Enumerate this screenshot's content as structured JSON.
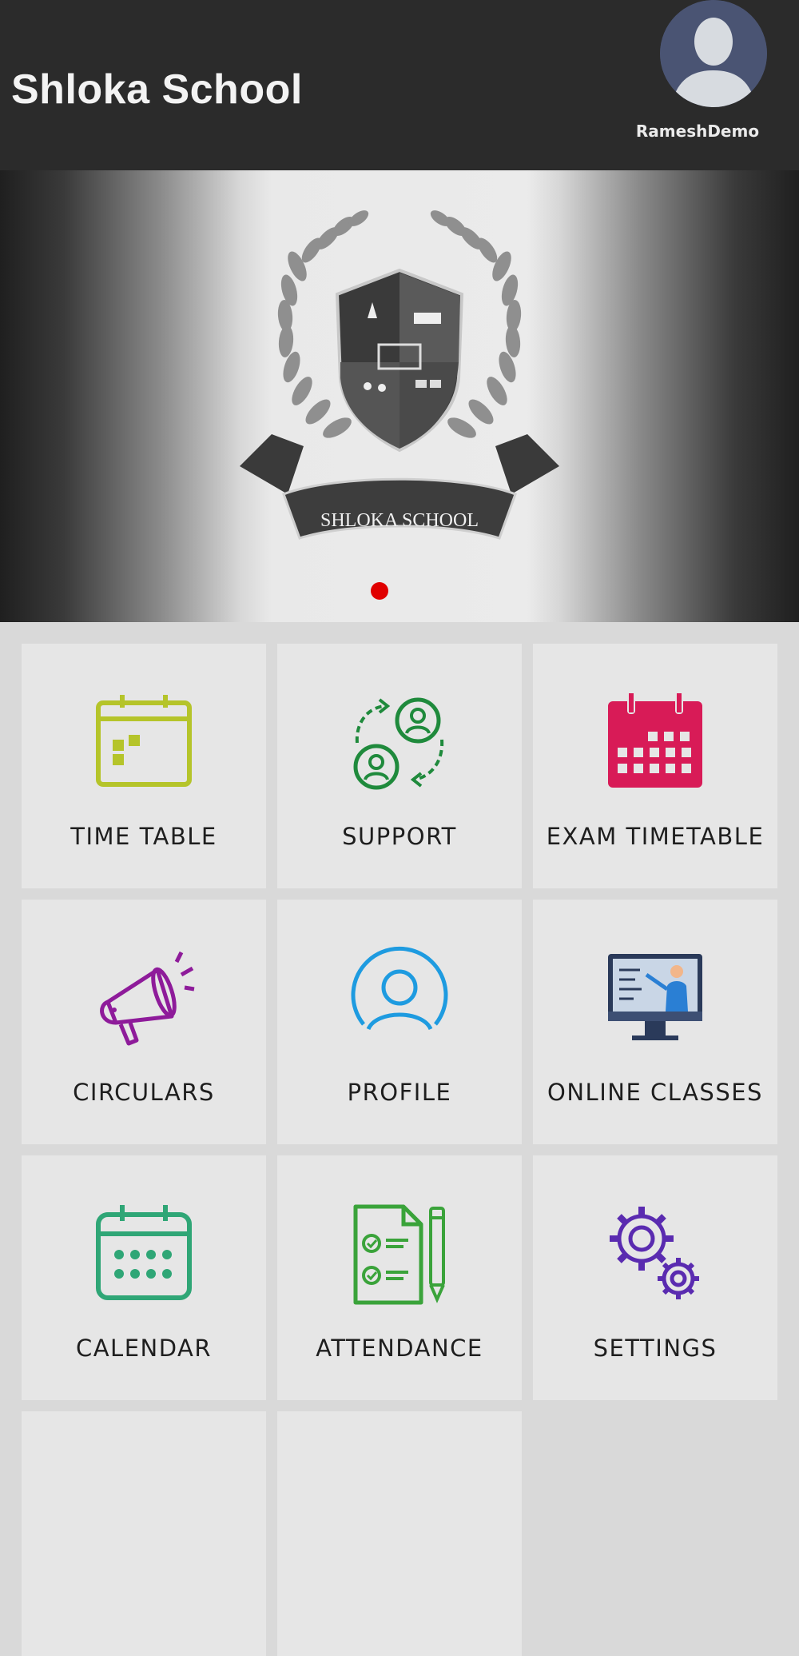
{
  "header": {
    "title": "Shloka School",
    "username": "RameshDemo",
    "background": "#2b2b2b"
  },
  "banner": {
    "logo_text": "SHLOKA SCHOOL",
    "pager": {
      "total": 1,
      "active": 0,
      "active_color": "#e00000"
    }
  },
  "menu": {
    "tiles": [
      {
        "label": "TIME TABLE",
        "icon": "timetable-calendar-icon",
        "color": "#b5c42a"
      },
      {
        "label": "SUPPORT",
        "icon": "support-exchange-icon",
        "color": "#1f8a3c"
      },
      {
        "label": "EXAM TIMETABLE",
        "icon": "exam-calendar-icon",
        "color": "#d81b57"
      },
      {
        "label": "CIRCULARS",
        "icon": "megaphone-icon",
        "color": "#8e1b9a"
      },
      {
        "label": "PROFILE",
        "icon": "profile-user-icon",
        "color": "#1e9be0"
      },
      {
        "label": "ONLINE CLASSES",
        "icon": "online-class-monitor-icon",
        "color": "#2a3a5a"
      },
      {
        "label": "CALENDAR",
        "icon": "calendar-icon",
        "color": "#2fa676"
      },
      {
        "label": "ATTENDANCE",
        "icon": "attendance-checklist-icon",
        "color": "#3aa33a"
      },
      {
        "label": "SETTINGS",
        "icon": "settings-gears-icon",
        "color": "#5a2bb0"
      }
    ]
  }
}
